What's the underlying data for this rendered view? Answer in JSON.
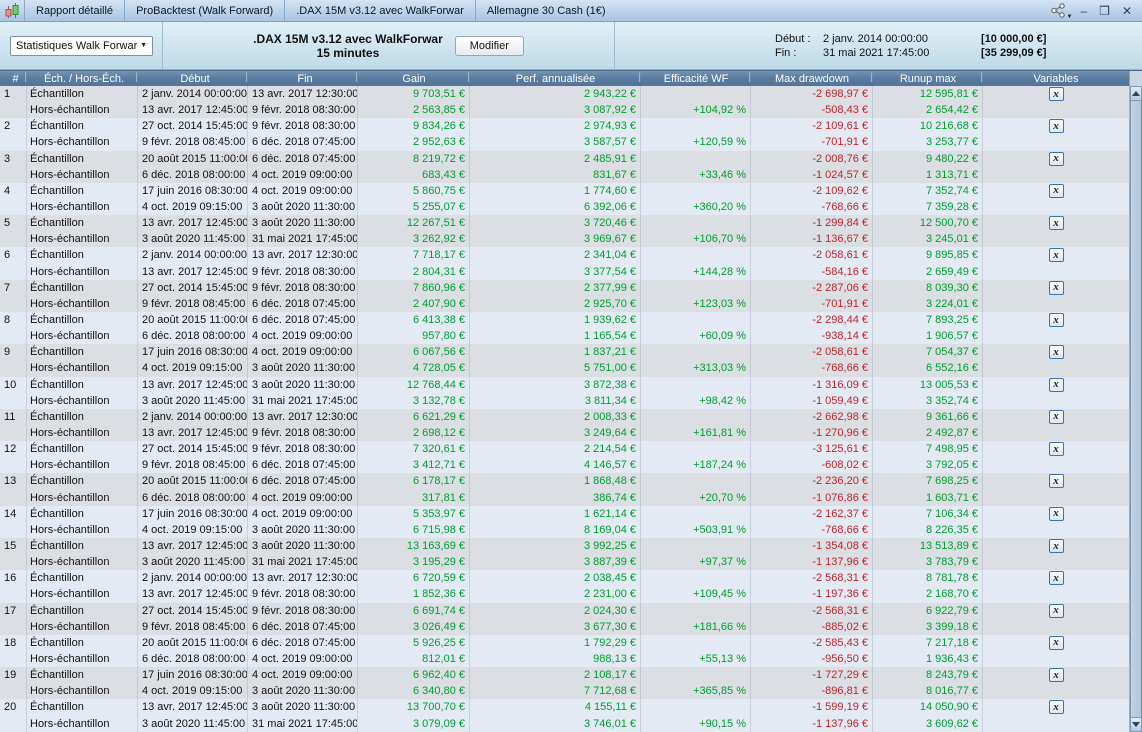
{
  "tabs": {
    "items": [
      "Rapport détaillé",
      "ProBacktest (Walk Forward)",
      ".DAX 15M v3.12 avec WalkForwar",
      "Allemagne 30 Cash (1€)"
    ]
  },
  "window_controls": {
    "minimize": "–",
    "maximize": "❒",
    "close": "✕"
  },
  "toolbar": {
    "stats_dropdown_value": "Statistiques Walk Forward",
    "title_line1": ".DAX 15M v3.12 avec WalkForwar",
    "title_line2": "15 minutes",
    "modify_button": "Modifier",
    "period": {
      "start_label": "Début :",
      "start_value": "2 janv. 2014 00:00:00",
      "start_amount": "[10 000,00 €]",
      "end_label": "Fin :",
      "end_value": "31 mai 2021 17:45:00",
      "end_amount": "[35 299,09 €]"
    }
  },
  "colors": {
    "positive": "#00a030",
    "negative": "#c0252c",
    "header_bg": "#5b7da0",
    "band_odd_group": "#dbdee3",
    "band_even_group": "#e3eaf3"
  },
  "table": {
    "columns": [
      "#",
      "Éch. / Hors-Éch.",
      "Début",
      "Fin",
      "Gain",
      "Perf. annualisée",
      "Efficacité WF",
      "Max drawdown",
      "Runup max",
      "Variables"
    ],
    "row_labels": {
      "in": "Échantillon",
      "out": "Hors-échantillon"
    },
    "variables_icon_glyph": "x",
    "groups": [
      {
        "num": "1",
        "in": {
          "debut": "2 janv. 2014 00:00:00",
          "fin": "13 avr. 2017 12:30:00",
          "gain": "9 703,51 €",
          "perf": "2 943,22 €",
          "eff": "",
          "maxdd": "-2 698,97 €",
          "runup": "12 595,81 €"
        },
        "out": {
          "debut": "13 avr. 2017 12:45:00",
          "fin": "9 févr. 2018 08:30:00",
          "gain": "2 563,85 €",
          "perf": "3 087,92 €",
          "eff": "+104,92 %",
          "maxdd": "-508,43 €",
          "runup": "2 654,42 €"
        }
      },
      {
        "num": "2",
        "in": {
          "debut": "27 oct. 2014 15:45:00",
          "fin": "9 févr. 2018 08:30:00",
          "gain": "9 834,26 €",
          "perf": "2 974,93 €",
          "eff": "",
          "maxdd": "-2 109,61 €",
          "runup": "10 216,68 €"
        },
        "out": {
          "debut": "9 févr. 2018 08:45:00",
          "fin": "6 déc. 2018 07:45:00",
          "gain": "2 952,63 €",
          "perf": "3 587,57 €",
          "eff": "+120,59 %",
          "maxdd": "-701,91 €",
          "runup": "3 253,77 €"
        }
      },
      {
        "num": "3",
        "in": {
          "debut": "20 août 2015 11:00:00",
          "fin": "6 déc. 2018 07:45:00",
          "gain": "8 219,72 €",
          "perf": "2 485,91 €",
          "eff": "",
          "maxdd": "-2 008,76 €",
          "runup": "9 480,22 €"
        },
        "out": {
          "debut": "6 déc. 2018 08:00:00",
          "fin": "4 oct. 2019 09:00:00",
          "gain": "683,43 €",
          "perf": "831,67 €",
          "eff": "+33,46 %",
          "maxdd": "-1 024,57 €",
          "runup": "1 313,71 €"
        }
      },
      {
        "num": "4",
        "in": {
          "debut": "17 juin 2016 08:30:00",
          "fin": "4 oct. 2019 09:00:00",
          "gain": "5 860,75 €",
          "perf": "1 774,60 €",
          "eff": "",
          "maxdd": "-2 109,62 €",
          "runup": "7 352,74 €"
        },
        "out": {
          "debut": "4 oct. 2019 09:15:00",
          "fin": "3 août 2020 11:30:00",
          "gain": "5 255,07 €",
          "perf": "6 392,06 €",
          "eff": "+360,20 %",
          "maxdd": "-768,66 €",
          "runup": "7 359,28 €"
        }
      },
      {
        "num": "5",
        "in": {
          "debut": "13 avr. 2017 12:45:00",
          "fin": "3 août 2020 11:30:00",
          "gain": "12 267,51 €",
          "perf": "3 720,46 €",
          "eff": "",
          "maxdd": "-1 299,84 €",
          "runup": "12 500,70 €"
        },
        "out": {
          "debut": "3 août 2020 11:45:00",
          "fin": "31 mai 2021 17:45:00",
          "gain": "3 262,92 €",
          "perf": "3 969,67 €",
          "eff": "+106,70 %",
          "maxdd": "-1 136,67 €",
          "runup": "3 245,01 €"
        }
      },
      {
        "num": "6",
        "in": {
          "debut": "2 janv. 2014 00:00:00",
          "fin": "13 avr. 2017 12:30:00",
          "gain": "7 718,17 €",
          "perf": "2 341,04 €",
          "eff": "",
          "maxdd": "-2 058,61 €",
          "runup": "9 895,85 €"
        },
        "out": {
          "debut": "13 avr. 2017 12:45:00",
          "fin": "9 févr. 2018 08:30:00",
          "gain": "2 804,31 €",
          "perf": "3 377,54 €",
          "eff": "+144,28 %",
          "maxdd": "-584,16 €",
          "runup": "2 659,49 €"
        }
      },
      {
        "num": "7",
        "in": {
          "debut": "27 oct. 2014 15:45:00",
          "fin": "9 févr. 2018 08:30:00",
          "gain": "7 860,96 €",
          "perf": "2 377,99 €",
          "eff": "",
          "maxdd": "-2 287,06 €",
          "runup": "8 039,30 €"
        },
        "out": {
          "debut": "9 févr. 2018 08:45:00",
          "fin": "6 déc. 2018 07:45:00",
          "gain": "2 407,90 €",
          "perf": "2 925,70 €",
          "eff": "+123,03 %",
          "maxdd": "-701,91 €",
          "runup": "3 224,01 €"
        }
      },
      {
        "num": "8",
        "in": {
          "debut": "20 août 2015 11:00:00",
          "fin": "6 déc. 2018 07:45:00",
          "gain": "6 413,38 €",
          "perf": "1 939,62 €",
          "eff": "",
          "maxdd": "-2 298,44 €",
          "runup": "7 893,25 €"
        },
        "out": {
          "debut": "6 déc. 2018 08:00:00",
          "fin": "4 oct. 2019 09:00:00",
          "gain": "957,80 €",
          "perf": "1 165,54 €",
          "eff": "+60,09 %",
          "maxdd": "-938,14 €",
          "runup": "1 906,57 €"
        }
      },
      {
        "num": "9",
        "in": {
          "debut": "17 juin 2016 08:30:00",
          "fin": "4 oct. 2019 09:00:00",
          "gain": "6 067,56 €",
          "perf": "1 837,21 €",
          "eff": "",
          "maxdd": "-2 058,61 €",
          "runup": "7 054,37 €"
        },
        "out": {
          "debut": "4 oct. 2019 09:15:00",
          "fin": "3 août 2020 11:30:00",
          "gain": "4 728,05 €",
          "perf": "5 751,00 €",
          "eff": "+313,03 %",
          "maxdd": "-768,66 €",
          "runup": "6 552,16 €"
        }
      },
      {
        "num": "10",
        "in": {
          "debut": "13 avr. 2017 12:45:00",
          "fin": "3 août 2020 11:30:00",
          "gain": "12 768,44 €",
          "perf": "3 872,38 €",
          "eff": "",
          "maxdd": "-1 316,09 €",
          "runup": "13 005,53 €"
        },
        "out": {
          "debut": "3 août 2020 11:45:00",
          "fin": "31 mai 2021 17:45:00",
          "gain": "3 132,78 €",
          "perf": "3 811,34 €",
          "eff": "+98,42 %",
          "maxdd": "-1 059,49 €",
          "runup": "3 352,74 €"
        }
      },
      {
        "num": "11",
        "in": {
          "debut": "2 janv. 2014 00:00:00",
          "fin": "13 avr. 2017 12:30:00",
          "gain": "6 621,29 €",
          "perf": "2 008,33 €",
          "eff": "",
          "maxdd": "-2 662,98 €",
          "runup": "9 361,66 €"
        },
        "out": {
          "debut": "13 avr. 2017 12:45:00",
          "fin": "9 févr. 2018 08:30:00",
          "gain": "2 698,12 €",
          "perf": "3 249,64 €",
          "eff": "+161,81 %",
          "maxdd": "-1 270,96 €",
          "runup": "2 492,87 €"
        }
      },
      {
        "num": "12",
        "in": {
          "debut": "27 oct. 2014 15:45:00",
          "fin": "9 févr. 2018 08:30:00",
          "gain": "7 320,61 €",
          "perf": "2 214,54 €",
          "eff": "",
          "maxdd": "-3 125,61 €",
          "runup": "7 498,95 €"
        },
        "out": {
          "debut": "9 févr. 2018 08:45:00",
          "fin": "6 déc. 2018 07:45:00",
          "gain": "3 412,71 €",
          "perf": "4 146,57 €",
          "eff": "+187,24 %",
          "maxdd": "-608,02 €",
          "runup": "3 792,05 €"
        }
      },
      {
        "num": "13",
        "in": {
          "debut": "20 août 2015 11:00:00",
          "fin": "6 déc. 2018 07:45:00",
          "gain": "6 178,17 €",
          "perf": "1 868,48 €",
          "eff": "",
          "maxdd": "-2 236,20 €",
          "runup": "7 698,25 €"
        },
        "out": {
          "debut": "6 déc. 2018 08:00:00",
          "fin": "4 oct. 2019 09:00:00",
          "gain": "317,81 €",
          "perf": "386,74 €",
          "eff": "+20,70 %",
          "maxdd": "-1 076,86 €",
          "runup": "1 603,71 €"
        }
      },
      {
        "num": "14",
        "in": {
          "debut": "17 juin 2016 08:30:00",
          "fin": "4 oct. 2019 09:00:00",
          "gain": "5 353,97 €",
          "perf": "1 621,14 €",
          "eff": "",
          "maxdd": "-2 162,37 €",
          "runup": "7 106,34 €"
        },
        "out": {
          "debut": "4 oct. 2019 09:15:00",
          "fin": "3 août 2020 11:30:00",
          "gain": "6 715,98 €",
          "perf": "8 169,04 €",
          "eff": "+503,91 %",
          "maxdd": "-768,66 €",
          "runup": "8 226,35 €"
        }
      },
      {
        "num": "15",
        "in": {
          "debut": "13 avr. 2017 12:45:00",
          "fin": "3 août 2020 11:30:00",
          "gain": "13 163,69 €",
          "perf": "3 992,25 €",
          "eff": "",
          "maxdd": "-1 354,08 €",
          "runup": "13 513,89 €"
        },
        "out": {
          "debut": "3 août 2020 11:45:00",
          "fin": "31 mai 2021 17:45:00",
          "gain": "3 195,29 €",
          "perf": "3 887,39 €",
          "eff": "+97,37 %",
          "maxdd": "-1 137,96 €",
          "runup": "3 783,79 €"
        }
      },
      {
        "num": "16",
        "in": {
          "debut": "2 janv. 2014 00:00:00",
          "fin": "13 avr. 2017 12:30:00",
          "gain": "6 720,59 €",
          "perf": "2 038,45 €",
          "eff": "",
          "maxdd": "-2 568,31 €",
          "runup": "8 781,78 €"
        },
        "out": {
          "debut": "13 avr. 2017 12:45:00",
          "fin": "9 févr. 2018 08:30:00",
          "gain": "1 852,36 €",
          "perf": "2 231,00 €",
          "eff": "+109,45 %",
          "maxdd": "-1 197,36 €",
          "runup": "2 168,70 €"
        }
      },
      {
        "num": "17",
        "in": {
          "debut": "27 oct. 2014 15:45:00",
          "fin": "9 févr. 2018 08:30:00",
          "gain": "6 691,74 €",
          "perf": "2 024,30 €",
          "eff": "",
          "maxdd": "-2 568,31 €",
          "runup": "6 922,79 €"
        },
        "out": {
          "debut": "9 févr. 2018 08:45:00",
          "fin": "6 déc. 2018 07:45:00",
          "gain": "3 026,49 €",
          "perf": "3 677,30 €",
          "eff": "+181,66 %",
          "maxdd": "-885,02 €",
          "runup": "3 399,18 €"
        }
      },
      {
        "num": "18",
        "in": {
          "debut": "20 août 2015 11:00:00",
          "fin": "6 déc. 2018 07:45:00",
          "gain": "5 926,25 €",
          "perf": "1 792,29 €",
          "eff": "",
          "maxdd": "-2 585,43 €",
          "runup": "7 217,18 €"
        },
        "out": {
          "debut": "6 déc. 2018 08:00:00",
          "fin": "4 oct. 2019 09:00:00",
          "gain": "812,01 €",
          "perf": "988,13 €",
          "eff": "+55,13 %",
          "maxdd": "-956,50 €",
          "runup": "1 936,43 €"
        }
      },
      {
        "num": "19",
        "in": {
          "debut": "17 juin 2016 08:30:00",
          "fin": "4 oct. 2019 09:00:00",
          "gain": "6 962,40 €",
          "perf": "2 108,17 €",
          "eff": "",
          "maxdd": "-1 727,29 €",
          "runup": "8 243,79 €"
        },
        "out": {
          "debut": "4 oct. 2019 09:15:00",
          "fin": "3 août 2020 11:30:00",
          "gain": "6 340,80 €",
          "perf": "7 712,68 €",
          "eff": "+365,85 %",
          "maxdd": "-896,81 €",
          "runup": "8 016,77 €"
        }
      },
      {
        "num": "20",
        "in": {
          "debut": "13 avr. 2017 12:45:00",
          "fin": "3 août 2020 11:30:00",
          "gain": "13 700,70 €",
          "perf": "4 155,11 €",
          "eff": "",
          "maxdd": "-1 599,19 €",
          "runup": "14 050,90 €"
        },
        "out": {
          "debut": "3 août 2020 11:45:00",
          "fin": "31 mai 2021 17:45:00",
          "gain": "3 079,09 €",
          "perf": "3 746,01 €",
          "eff": "+90,15 %",
          "maxdd": "-1 137,96 €",
          "runup": "3 609,62 €"
        }
      }
    ]
  }
}
